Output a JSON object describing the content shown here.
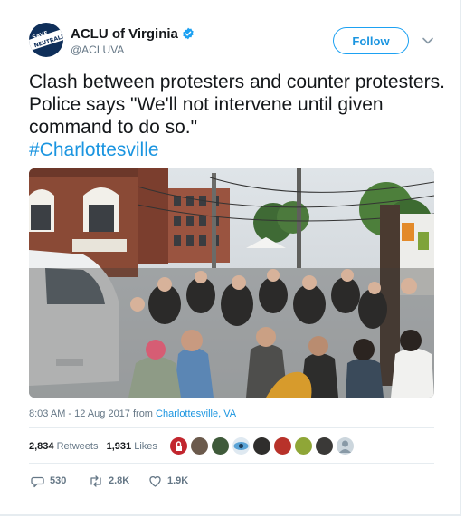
{
  "account": {
    "name": "ACLU of Virginia",
    "handle": "@ACLUVA",
    "avatar_text_top": "SAVE NET",
    "avatar_text_bottom": "NEUTRALITY"
  },
  "follow_label": "Follow",
  "tweet": {
    "text": "Clash between protesters and counter protesters. Police says \"We'll not intervene until given command to do so.\"",
    "hashtag": "#Charlottesville"
  },
  "meta": {
    "timestamp": "8:03 AM - 12 Aug 2017 from ",
    "location": "Charlottesville, VA"
  },
  "stats": {
    "retweets_count": "2,834",
    "retweets_label": "Retweets",
    "likes_count": "1,931",
    "likes_label": "Likes"
  },
  "actions": {
    "reply_count": "530",
    "retweet_count": "2.8K",
    "like_count": "1.9K"
  },
  "colors": {
    "accent": "#1da1f2",
    "link": "#1b95e0",
    "text": "#14171a",
    "muted": "#657786",
    "border": "#e6ecf0"
  }
}
